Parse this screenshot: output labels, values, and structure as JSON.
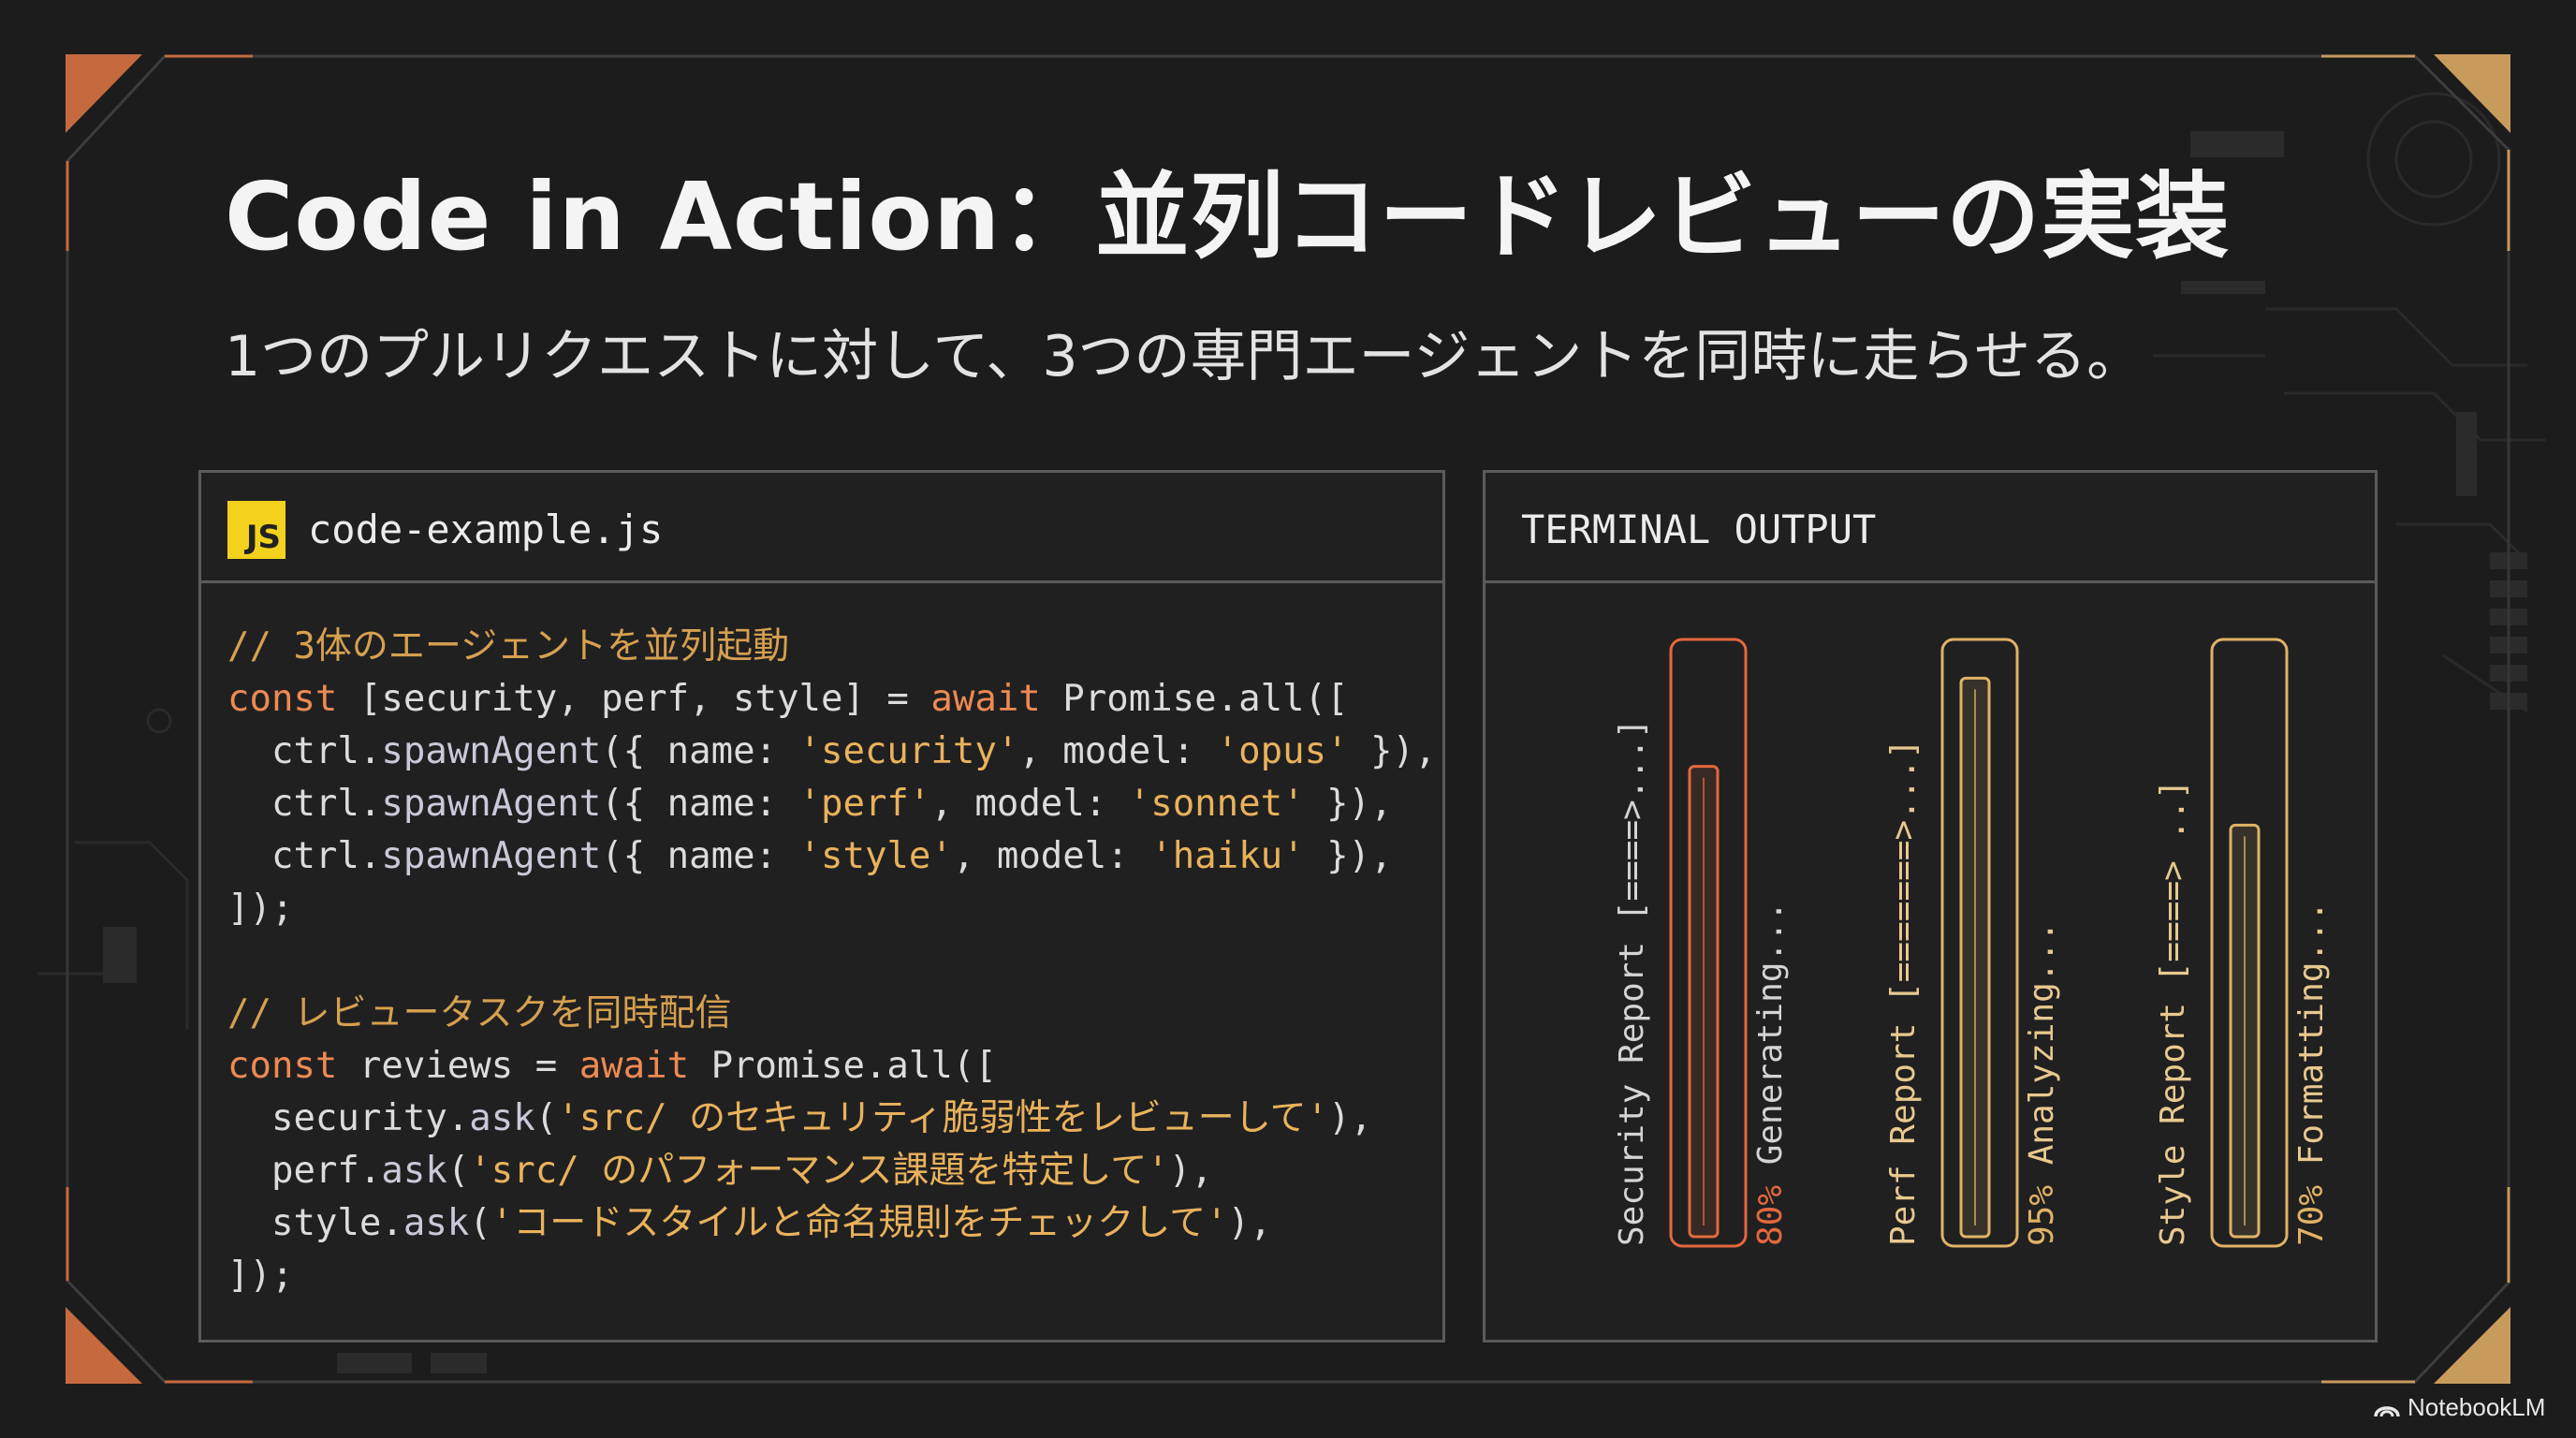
{
  "slide": {
    "title": "Code in Action：並列コードレビューの実装",
    "subtitle": "1つのプルリクエストに対して、3つの専門エージェントを同時に走らせる。"
  },
  "code_panel": {
    "badge": "JS",
    "filename": "code-example.js",
    "lines": [
      [
        {
          "t": "// 3体のエージェントを並列起動",
          "c": "c-com"
        }
      ],
      [
        {
          "t": "const",
          "c": "c-kw"
        },
        {
          "t": " [security, perf, style] = ",
          "c": "c-plain"
        },
        {
          "t": "await",
          "c": "c-kw"
        },
        {
          "t": " Promise.all([",
          "c": "c-plain"
        }
      ],
      [
        {
          "t": "  ctrl.",
          "c": "c-plain"
        },
        {
          "t": "spawnAgent",
          "c": "c-fn"
        },
        {
          "t": "({ name: ",
          "c": "c-plain"
        },
        {
          "t": "'security'",
          "c": "c-str"
        },
        {
          "t": ", model: ",
          "c": "c-plain"
        },
        {
          "t": "'opus'",
          "c": "c-str"
        },
        {
          "t": " }),",
          "c": "c-plain"
        }
      ],
      [
        {
          "t": "  ctrl.",
          "c": "c-plain"
        },
        {
          "t": "spawnAgent",
          "c": "c-fn"
        },
        {
          "t": "({ name: ",
          "c": "c-plain"
        },
        {
          "t": "'perf'",
          "c": "c-str"
        },
        {
          "t": ", model: ",
          "c": "c-plain"
        },
        {
          "t": "'sonnet'",
          "c": "c-str"
        },
        {
          "t": " }),",
          "c": "c-plain"
        }
      ],
      [
        {
          "t": "  ctrl.",
          "c": "c-plain"
        },
        {
          "t": "spawnAgent",
          "c": "c-fn"
        },
        {
          "t": "({ name: ",
          "c": "c-plain"
        },
        {
          "t": "'style'",
          "c": "c-str"
        },
        {
          "t": ", model: ",
          "c": "c-plain"
        },
        {
          "t": "'haiku'",
          "c": "c-str"
        },
        {
          "t": " }),",
          "c": "c-plain"
        }
      ],
      [
        {
          "t": "]);",
          "c": "c-plain"
        }
      ],
      [
        {
          "t": "",
          "c": "c-plain"
        }
      ],
      [
        {
          "t": "// レビュータスクを同時配信",
          "c": "c-com"
        }
      ],
      [
        {
          "t": "const",
          "c": "c-kw"
        },
        {
          "t": " reviews = ",
          "c": "c-plain"
        },
        {
          "t": "await",
          "c": "c-kw"
        },
        {
          "t": " Promise.all([",
          "c": "c-plain"
        }
      ],
      [
        {
          "t": "  security.",
          "c": "c-plain"
        },
        {
          "t": "ask",
          "c": "c-fn"
        },
        {
          "t": "(",
          "c": "c-plain"
        },
        {
          "t": "'src/ のセキュリティ脆弱性をレビューして'",
          "c": "c-str"
        },
        {
          "t": "),",
          "c": "c-plain"
        }
      ],
      [
        {
          "t": "  perf.",
          "c": "c-plain"
        },
        {
          "t": "ask",
          "c": "c-fn"
        },
        {
          "t": "(",
          "c": "c-plain"
        },
        {
          "t": "'src/ のパフォーマンス課題を特定して'",
          "c": "c-str"
        },
        {
          "t": "),",
          "c": "c-plain"
        }
      ],
      [
        {
          "t": "  style.",
          "c": "c-plain"
        },
        {
          "t": "ask",
          "c": "c-fn"
        },
        {
          "t": "(",
          "c": "c-plain"
        },
        {
          "t": "'コードスタイルと命名規則をチェックして'",
          "c": "c-str"
        },
        {
          "t": "),",
          "c": "c-plain"
        }
      ],
      [
        {
          "t": "]);",
          "c": "c-plain"
        }
      ]
    ]
  },
  "terminal": {
    "title": "TERMINAL OUTPUT",
    "reports": [
      {
        "label": "Security Report [====>...]",
        "status": "80% Generating...",
        "percent": 80,
        "color": "#e4683d",
        "text_color": "#d4d4d4"
      },
      {
        "label": "Perf Report [=======>...]",
        "status": "95% Analyzing...",
        "percent": 95,
        "color": "#e0b266",
        "text_color": "#e7c98f"
      },
      {
        "label": "Style Report [====> ..]",
        "status": "70% Formatting...",
        "percent": 70,
        "color": "#e0b266",
        "text_color": "#e7c98f"
      }
    ]
  },
  "watermark": "NotebookLM"
}
